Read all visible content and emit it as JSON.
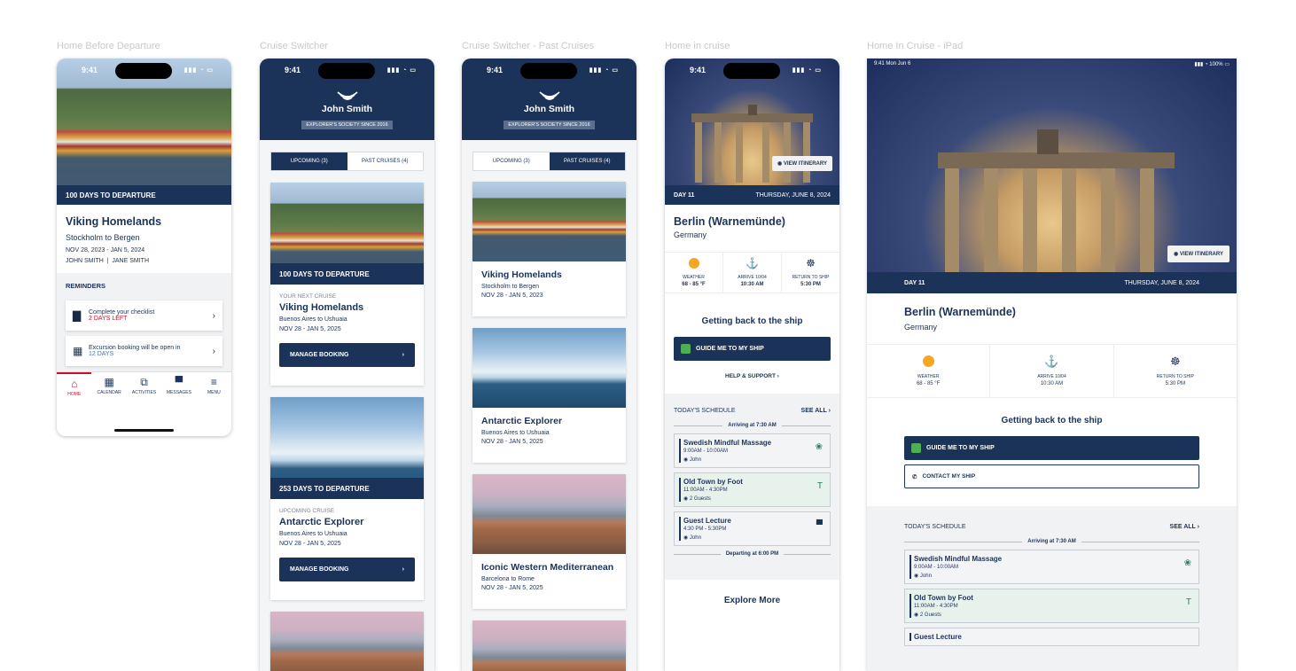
{
  "frames": {
    "f1": "Home Before Departure",
    "f2": "Cruise Switcher",
    "f3": "Cruise Switcher - Past Cruises",
    "f4": "Home in cruise",
    "f5": "Home In Cruise - iPad"
  },
  "status": {
    "time": "9:41",
    "ipad_time": "9:41  Mon Jun 6",
    "ipad_batt": "100%"
  },
  "home": {
    "departure": "100 DAYS TO DEPARTURE",
    "title": "Viking Homelands",
    "route": "Stockholm to Bergen",
    "dates": "NOV 28, 2023 - JAN 5, 2024",
    "guest1": "JOHN SMITH",
    "guest2": "JANE SMITH",
    "reminders_title": "REMINDERS",
    "rem1_title": "Complete your checklist",
    "rem1_sub": "2 DAYS LEFT",
    "rem2_title": "Excursion booking will be open in",
    "rem2_sub": "12 DAYS",
    "nav": [
      "HOME",
      "CALENDAR",
      "ACTIVITIES",
      "MESSAGES",
      "MENU"
    ]
  },
  "switcher": {
    "name": "John Smith",
    "society": "EXPLORER'S SOCIETY SINCE 2016",
    "tab_upcoming": "UPCOMING (3)",
    "tab_past": "PAST CRUISES (4)",
    "c1_departure": "100 DAYS TO DEPARTURE",
    "c1_label": "YOUR NEXT CRUISE",
    "c1_title": "Viking Homelands",
    "c1_route": "Buenos Aires to Ushuaia",
    "c1_dates": "NOV 28 -  JAN 5, 2025",
    "c2_departure": "253 DAYS TO DEPARTURE",
    "c2_label": "UPCOMING CRUISE",
    "c2_title": "Antarctic Explorer",
    "c2_route": "Buenos Aires to Ushuaia",
    "c2_dates": "NOV 28 -  JAN 5, 2025",
    "manage": "MANAGE BOOKING"
  },
  "past": {
    "p1_title": "Viking Homelands",
    "p1_route": "Stockholm to Bergen",
    "p1_dates": "NOV 28 -  JAN 5, 2023",
    "p2_title": "Antarctic Explorer",
    "p2_route": "Buenos Aires to Ushuaia",
    "p2_dates": "NOV 28 -  JAN 5, 2025",
    "p3_title": "Iconic Western Mediterranean",
    "p3_route": "Barcelona to Rome",
    "p3_dates": "NOV 28 -  JAN 5, 2025"
  },
  "incruise": {
    "view_itinerary": "VIEW ITINERARY",
    "day": "DAY 11",
    "date": "THURSDAY, JUNE 8, 2024",
    "city": "Berlin (Warnemünde)",
    "country": "Germany",
    "weather_label": "WEATHER",
    "weather_value": "68 - 85  °F",
    "arrive_label": "ARRIVE 10/04",
    "arrive_value": "10:30 AM",
    "return_label": "RETURN TO SHIP",
    "return_value": "5:30 PM",
    "back_title": "Getting back to the ship",
    "guide": "GUIDE ME TO MY SHIP",
    "help": "HELP & SUPPORT",
    "contact": "CONTACT MY SHIP",
    "schedule_title": "TODAY'S SCHEDULE",
    "see_all": "SEE ALL",
    "arriving": "Arriving at 7:30 AM",
    "departing": "Departing at 6:00 PM",
    "e1_title": "Swedish Mindful Massage",
    "e1_time": "9:00AM - 10:00AM",
    "e1_who": "John",
    "e2_title": "Old Town by Foot",
    "e2_time": "11:00AM - 4:30PM",
    "e2_who": "2 Guests",
    "e3_title": "Guest Lecture",
    "e3_time": "4:30 PM - 5:30PM",
    "e3_who": "John",
    "explore": "Explore More"
  },
  "colors": {
    "navy": "#1b3358",
    "accent_red": "#c8102e",
    "sun": "#f5a623"
  }
}
